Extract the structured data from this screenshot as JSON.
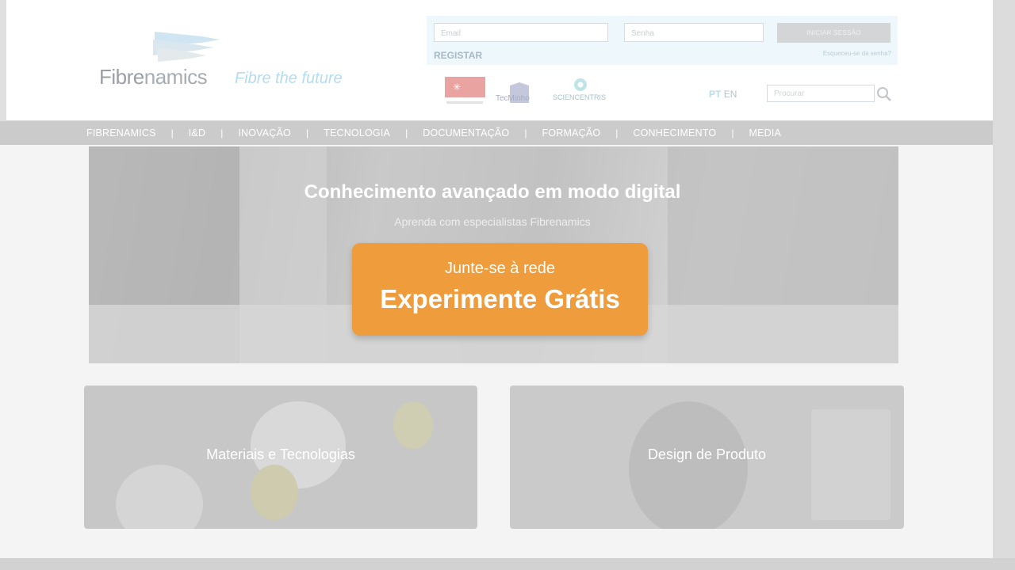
{
  "header": {
    "logo_prefix": "Fibre",
    "logo_suffix": "namics",
    "tagline": "Fibre the future"
  },
  "login": {
    "email_placeholder": "Email",
    "password_placeholder": "Senha",
    "login_button": "INICIAR SESSÃO",
    "register_link": "REGISTAR",
    "forgot_link": "Esqueceu-se da senha?"
  },
  "partners": {
    "techminho_label": "TecMinho",
    "sciencentris_label": "SCIENCENTRIS"
  },
  "language": {
    "pt": "PT",
    "en": "EN"
  },
  "search": {
    "placeholder": "Procurar"
  },
  "nav": {
    "items": [
      "FIBRENAMICS",
      "I&D",
      "INOVAÇÃO",
      "TECNOLOGIA",
      "DOCUMENTAÇÃO",
      "FORMAÇÃO",
      "CONHECIMENTO",
      "MEDIA"
    ],
    "separator": "|"
  },
  "hero": {
    "title": "Conhecimento avançado em modo digital",
    "subtitle": "Aprenda com especialistas Fibrenamics",
    "cta_small": "Junte-se à rede",
    "cta_big": "Experimente Grátis"
  },
  "cards": [
    {
      "label": "Materiais e Tecnologias"
    },
    {
      "label": "Design de Produto"
    }
  ],
  "colors": {
    "accent_orange": "#ee9c3c",
    "nav_bg": "#cbcbcb",
    "tagline_blue": "#b5dcef"
  }
}
